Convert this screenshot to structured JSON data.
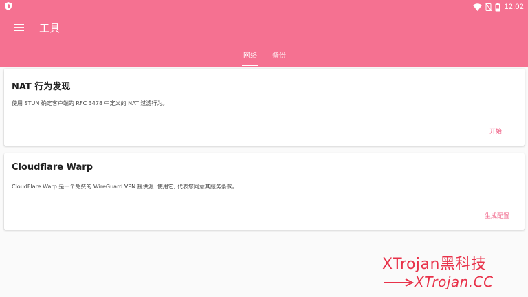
{
  "status_bar": {
    "time": "12:02",
    "icons": [
      "shield-icon",
      "wifi-icon",
      "battery-saver-icon",
      "battery-icon"
    ]
  },
  "toolbar": {
    "menu_icon": "menu-icon",
    "title": "工具"
  },
  "tabs": [
    {
      "label": "网络",
      "selected": true
    },
    {
      "label": "备份",
      "selected": false
    }
  ],
  "cards": [
    {
      "title": "NAT 行为发现",
      "description": "使用 STUN 确定客户端的 RFC 3478 中定义的 NAT 过滤行为。",
      "action": "开始"
    },
    {
      "title": "Cloudflare Warp",
      "description": "CloudFlare Warp 是一个免费的 WireGuard VPN 提供源. 使用它, 代表您同意其服务条款。",
      "action": "生成配置"
    }
  ],
  "watermark": {
    "line1": "XTrojan黑科技",
    "line2": "XTrojan.CC"
  },
  "colors": {
    "accent": "#f57191",
    "action_text": "#f0668a",
    "watermark": "#e8324a"
  }
}
